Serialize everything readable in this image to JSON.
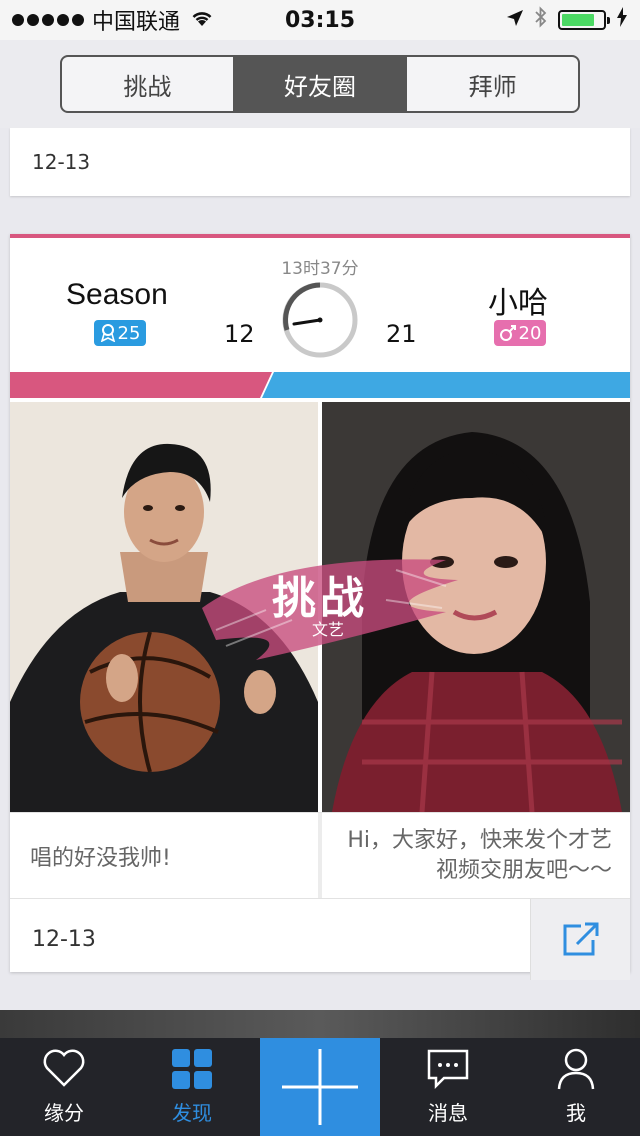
{
  "status_bar": {
    "carrier": "中国联通",
    "time": "03:15",
    "battery_color": "#4cd964"
  },
  "segmented": {
    "items": [
      {
        "label": "挑战"
      },
      {
        "label": "好友圈"
      },
      {
        "label": "拜师"
      }
    ],
    "active_index": 1
  },
  "prev_card": {
    "date": "12-13"
  },
  "challenge_card": {
    "timer": "13时37分",
    "left": {
      "name": "Season",
      "badge": "25",
      "score": "12",
      "caption": "唱的好没我帅!"
    },
    "right": {
      "name": "小哈",
      "badge": "20",
      "score": "21",
      "caption": "Hi，大家好，快来发个才艺视频交朋友吧～～"
    },
    "stamp": {
      "title": "挑战",
      "category": "文艺"
    },
    "date": "12-13",
    "colors": {
      "left": "#d8577f",
      "right": "#3ea8e3"
    }
  },
  "tabbar": {
    "items": [
      {
        "label": "缘分",
        "icon": "heart-icon"
      },
      {
        "label": "发现",
        "icon": "grid-icon"
      },
      {
        "label": "",
        "icon": "plus-icon"
      },
      {
        "label": "消息",
        "icon": "message-icon"
      },
      {
        "label": "我",
        "icon": "person-icon"
      }
    ],
    "active_index": 1
  }
}
